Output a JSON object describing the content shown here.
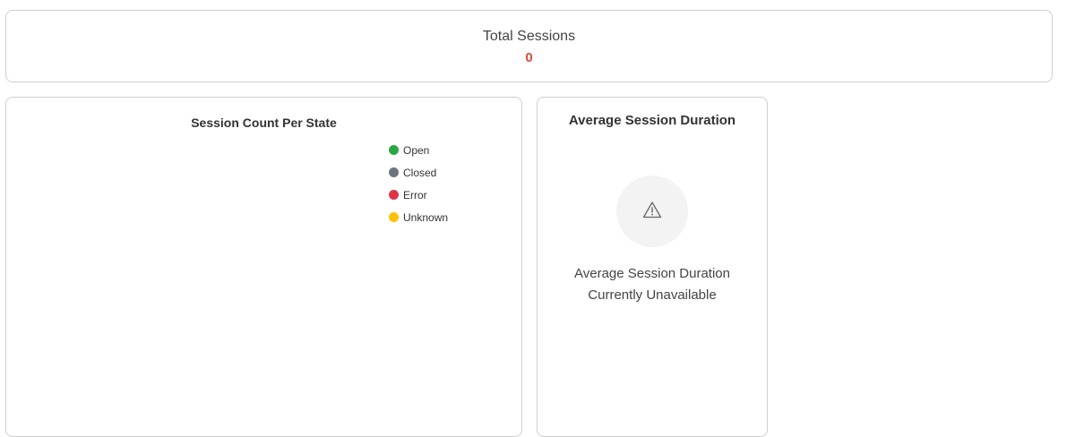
{
  "total": {
    "title": "Total Sessions",
    "value": "0",
    "value_color": "#e0473a"
  },
  "state_chart": {
    "title": "Session Count Per State",
    "legend": [
      {
        "label": "Open",
        "color": "#28a745"
      },
      {
        "label": "Closed",
        "color": "#6c757d"
      },
      {
        "label": "Error",
        "color": "#dc3545"
      },
      {
        "label": "Unknown",
        "color": "#ffc107"
      }
    ]
  },
  "duration": {
    "title": "Average Session Duration",
    "icon": "warning-icon",
    "message_line1": "Average Session Duration",
    "message_line2": "Currently Unavailable"
  },
  "colors": {
    "border": "#cfcfcf",
    "icon_bg": "#f3f3f3"
  }
}
